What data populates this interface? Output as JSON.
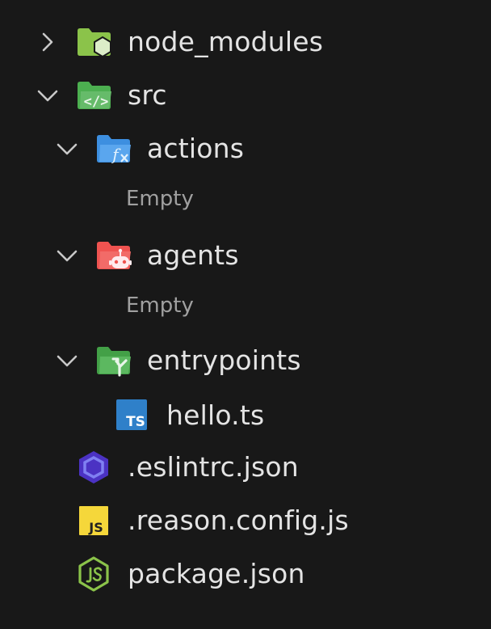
{
  "explorer": {
    "items": [
      {
        "label": "node_modules",
        "icon": "folder-node-icon",
        "expanded": false
      },
      {
        "label": "src",
        "icon": "folder-src-icon",
        "expanded": true
      },
      {
        "label": "actions",
        "icon": "folder-functions-icon",
        "expanded": true
      },
      {
        "label": "agents",
        "icon": "folder-robot-icon",
        "expanded": true
      },
      {
        "label": "entrypoints",
        "icon": "folder-entry-icon",
        "expanded": true
      },
      {
        "label": "hello.ts",
        "icon": "typescript-icon"
      },
      {
        "label": ".eslintrc.json",
        "icon": "eslint-icon"
      },
      {
        "label": ".reason.config.js",
        "icon": "javascript-icon"
      },
      {
        "label": "package.json",
        "icon": "nodejs-icon"
      }
    ],
    "empty_text": "Empty",
    "icon_badges": {
      "typescript": "TS",
      "javascript": "JS"
    }
  },
  "colors": {
    "background": "#181818",
    "node_folder": "#8bc34a",
    "src_folder": "#4caf50",
    "actions_folder": "#3d8fe0",
    "agents_folder": "#ef5350",
    "entry_folder": "#43a047",
    "typescript": "#2f80c9",
    "eslint": "#4b32c3",
    "javascript": "#f5d73a",
    "nodejs": "#8bc34a"
  }
}
